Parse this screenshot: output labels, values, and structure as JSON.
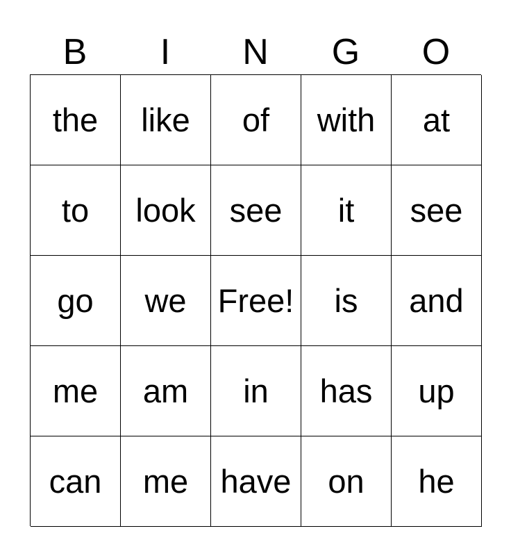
{
  "header": [
    "B",
    "I",
    "N",
    "G",
    "O"
  ],
  "cells": [
    [
      "the",
      "like",
      "of",
      "with",
      "at"
    ],
    [
      "to",
      "look",
      "see",
      "it",
      "see"
    ],
    [
      "go",
      "we",
      "Free!",
      "is",
      "and"
    ],
    [
      "me",
      "am",
      "in",
      "has",
      "up"
    ],
    [
      "can",
      "me",
      "have",
      "on",
      "he"
    ]
  ]
}
